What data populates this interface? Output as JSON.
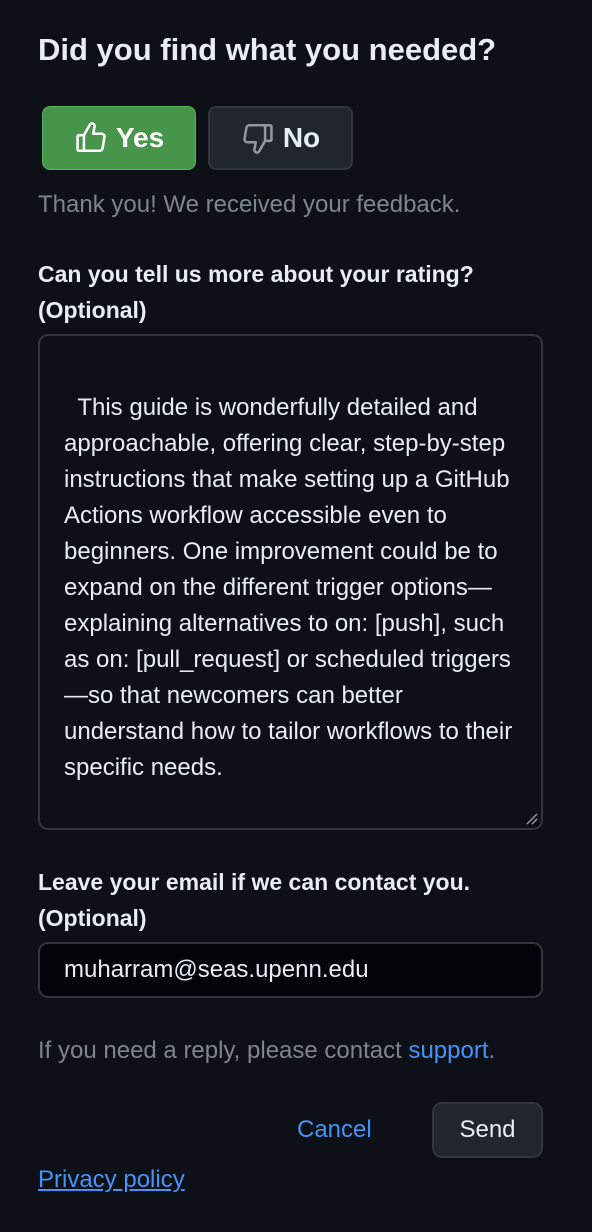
{
  "feedback": {
    "heading": "Did you find what you needed?",
    "yes_button": {
      "label": "Yes",
      "icon": "thumbs-up-icon",
      "state": "selected",
      "color": "#46954a"
    },
    "no_button": {
      "label": "No",
      "icon": "thumbs-down-icon"
    },
    "confirmation": "Thank you! We received your feedback.",
    "rating": {
      "label_line1": "Can you tell us more about your rating?",
      "label_line2": "(Optional)",
      "value": "This guide is wonderfully detailed and approachable, offering clear, step-by-step instructions that make setting up a GitHub Actions workflow accessible even to beginners. One improvement could be to expand on the different trigger options—explaining alternatives to on: [push], such as on: [pull_request] or scheduled triggers—so that newcomers can better understand how to tailor workflows to their specific needs."
    },
    "email": {
      "label_line1": "Leave your email if we can contact you.",
      "label_line2": "(Optional)",
      "value": "muharram@seas.upenn.edu"
    },
    "reply_note": {
      "text": "If you need a reply, please contact ",
      "link": "support",
      "suffix": "."
    },
    "actions": {
      "cancel": "Cancel",
      "send": "Send"
    },
    "privacy_link": "Privacy policy"
  },
  "colors": {
    "background": "#0d1117",
    "accent_link": "#4493f8",
    "muted_text": "#7d8590",
    "success": "#46954a"
  }
}
